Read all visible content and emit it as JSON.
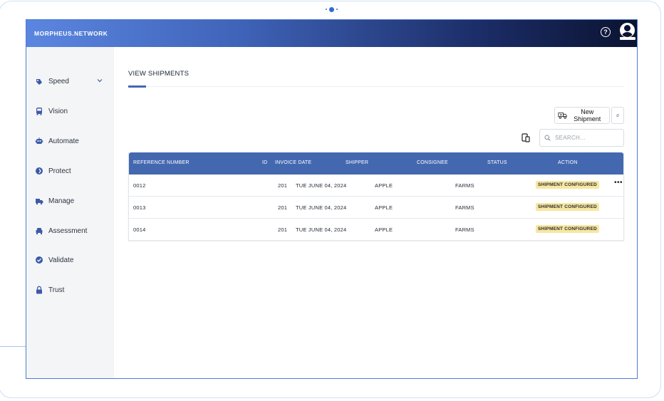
{
  "header": {
    "brand": "MORPHEUS.NETWORK"
  },
  "sidebar": {
    "items": [
      {
        "label": "Speed",
        "icon": "speed-icon",
        "has_chevron": true
      },
      {
        "label": "Vision",
        "icon": "bus-icon"
      },
      {
        "label": "Automate",
        "icon": "robot-icon"
      },
      {
        "label": "Protect",
        "icon": "shield-icon"
      },
      {
        "label": "Manage",
        "icon": "truck-icon"
      },
      {
        "label": "Assessment",
        "icon": "car-icon"
      },
      {
        "label": "Validate",
        "icon": "check-badge-icon"
      },
      {
        "label": "Trust",
        "icon": "lock-icon"
      }
    ]
  },
  "main": {
    "title": "VIEW SHIPMENTS",
    "new_shipment_label": "New Shipment",
    "search_placeholder": "SEARCH..."
  },
  "table": {
    "columns": [
      "REFERENCE NUMBER",
      "ID",
      "INVOICE DATE",
      "SHIPPER",
      "CONSIGNEE",
      "STATUS",
      "ACTION"
    ],
    "rows": [
      {
        "reference": "0012",
        "id": "201",
        "invoice_date": "TUE JUNE 04, 2024",
        "shipper": "APPLE",
        "consignee": "FARMS",
        "status": "SHIPMENT CONFIGURED",
        "has_menu": true
      },
      {
        "reference": "0013",
        "id": "201",
        "invoice_date": "TUE JUNE 04, 2024",
        "shipper": "APPLE",
        "consignee": "FARMS",
        "status": "SHIPMENT CONFIGURED",
        "has_menu": false
      },
      {
        "reference": "0014",
        "id": "201",
        "invoice_date": "TUE JUNE 04, 2024",
        "shipper": "APPLE",
        "consignee": "FARMS",
        "status": "SHIPMENT CONFIGURED",
        "has_menu": false
      }
    ]
  },
  "colors": {
    "accent": "#4468b0",
    "badge": "#f7e7a1",
    "sidebar_bg": "#f4f5f7"
  }
}
